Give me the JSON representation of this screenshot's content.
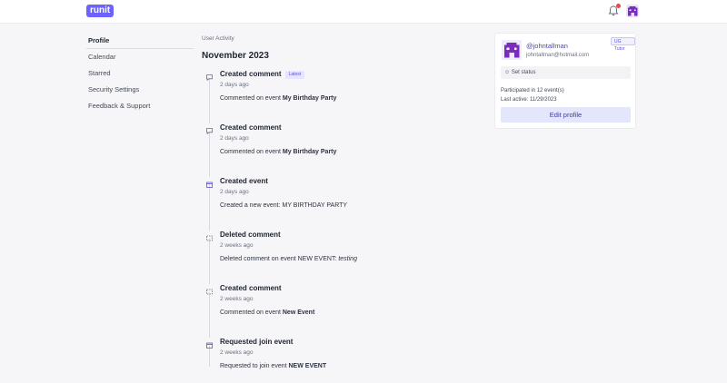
{
  "app": {
    "logo_text": "runit"
  },
  "header": {
    "notification_icon": "bell-icon",
    "avatar_icon": "pixel-avatar-icon"
  },
  "sidebar": {
    "items": [
      {
        "label": "Profile",
        "active": true
      },
      {
        "label": "Calendar"
      },
      {
        "label": "Starred"
      },
      {
        "label": "Security Settings"
      },
      {
        "label": "Feedback & Support"
      }
    ]
  },
  "main": {
    "section_label": "User Activity",
    "month": "November 2023",
    "activities": [
      {
        "icon": "comment-icon",
        "title": "Created comment",
        "badge": "Latest",
        "time": "2 days ago",
        "desc_prefix": "Commented on event ",
        "desc_bold": "My Birthday Party"
      },
      {
        "icon": "comment-icon",
        "title": "Created comment",
        "time": "2 days ago",
        "desc_prefix": "Commented on event ",
        "desc_bold": "My Birthday Party"
      },
      {
        "icon": "calendar-icon",
        "title": "Created event",
        "time": "2 days ago",
        "desc_prefix": "Created a new event: MY BIRTHDAY PARTY",
        "desc_bold": ""
      },
      {
        "icon": "comment-icon",
        "title": "Deleted comment",
        "time": "2 weeks ago",
        "desc_prefix": "Deleted comment on event NEW EVENT: ",
        "desc_italic": "testing"
      },
      {
        "icon": "comment-icon",
        "title": "Created comment",
        "time": "2 weeks ago",
        "desc_prefix": "Commented on event ",
        "desc_bold": "New Event"
      },
      {
        "icon": "calendar-icon",
        "title": "Requested join event",
        "time": "2 weeks ago",
        "desc_prefix": "Requested to join event ",
        "desc_bold": "NEW EVENT"
      }
    ]
  },
  "profile_card": {
    "username": "@johntallman",
    "email": "johntallman@hotmail.com",
    "tag": "UG Tutor",
    "set_status_label": "Set status",
    "participated": "Participated in 12 event(s)",
    "last_active": "Last active: 11/29/2023",
    "edit_button": "Edit profile"
  }
}
